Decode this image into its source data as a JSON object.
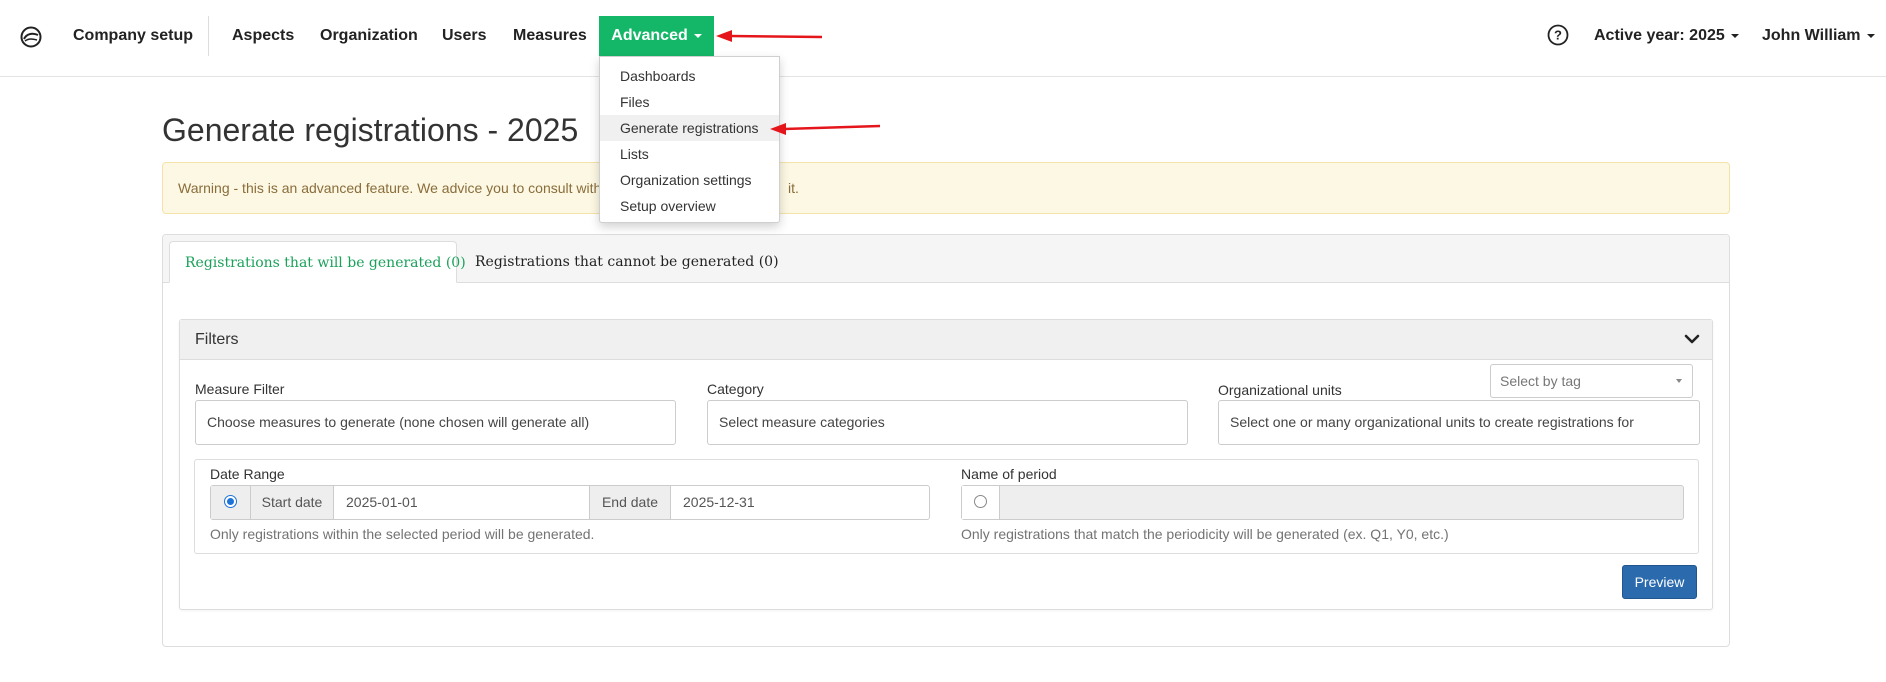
{
  "navbar": {
    "logo_icon": "leaf-circle-icon",
    "items": [
      {
        "label": "Company setup"
      },
      {
        "label": "Aspects"
      },
      {
        "label": "Organization"
      },
      {
        "label": "Users"
      },
      {
        "label": "Measures"
      },
      {
        "label": "Advanced"
      }
    ],
    "help_icon": "question-circle-icon",
    "active_year": "Active year: 2025",
    "user": "John William",
    "accent_color": "#14b767"
  },
  "dropdown": {
    "items": [
      {
        "label": "Dashboards"
      },
      {
        "label": "Files"
      },
      {
        "label": "Generate registrations",
        "active": true
      },
      {
        "label": "Lists"
      },
      {
        "label": "Organization settings"
      },
      {
        "label": "Setup overview"
      }
    ]
  },
  "annotations": {
    "arrow_color": "#e5161b"
  },
  "page": {
    "title": "Generate registrations - 2025",
    "warning": "Warning - this is an advanced feature. We advice you to consult with",
    "warning_tail": "it.",
    "warning_color": "#fcf8e3"
  },
  "tabs": [
    {
      "label": "Registrations that will be generated (0)",
      "active": true
    },
    {
      "label": "Registrations that cannot be generated (0)",
      "active": false
    }
  ],
  "filters": {
    "title": "Filters",
    "chevron_icon": "chevron-down-icon",
    "measure_filter": {
      "label": "Measure Filter",
      "placeholder": "Choose measures to generate (none chosen will generate all)"
    },
    "category": {
      "label": "Category",
      "placeholder": "Select measure categories"
    },
    "org_units": {
      "label": "Organizational units",
      "placeholder": "Select one or many organizational units to create registrations for"
    },
    "tag_select": {
      "placeholder": "Select by tag"
    },
    "date_range": {
      "label": "Date Range",
      "start_label": "Start date",
      "start_value": "2025-01-01",
      "end_label": "End date",
      "end_value": "2025-12-31",
      "help": "Only registrations within the selected period will be generated.",
      "selected": true
    },
    "period": {
      "label": "Name of period",
      "value": "",
      "help": "Only registrations that match the periodicity will be generated (ex. Q1, Y0, etc.)",
      "selected": false
    },
    "preview_button": "Preview"
  }
}
